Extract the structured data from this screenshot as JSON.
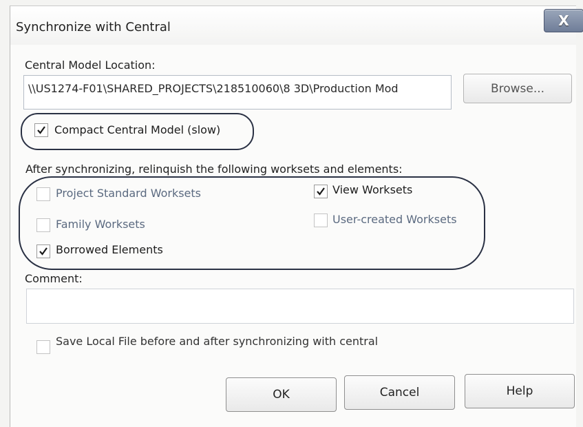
{
  "dialog": {
    "title": "Synchronize with Central",
    "close_glyph": "X"
  },
  "central_model": {
    "label": "Central Model Location:",
    "path": "\\\\US1274-F01\\SHARED_PROJECTS\\218510060\\8 3D\\Production Mod",
    "browse_label": "Browse..."
  },
  "compact": {
    "label": "Compact Central Model (slow)",
    "checked": true
  },
  "relinquish": {
    "heading": "After synchronizing, relinquish the following worksets and elements:",
    "items": [
      {
        "label": "Project Standard Worksets",
        "checked": false,
        "enabled": false
      },
      {
        "label": "Family Worksets",
        "checked": false,
        "enabled": false
      },
      {
        "label": "Borrowed Elements",
        "checked": true,
        "enabled": true
      },
      {
        "label": "View Worksets",
        "checked": true,
        "enabled": true
      },
      {
        "label": "User-created Worksets",
        "checked": false,
        "enabled": false
      }
    ]
  },
  "comment": {
    "label": "Comment:",
    "value": ""
  },
  "save_local": {
    "label": "Save Local File before and after synchronizing with central",
    "checked": false
  },
  "buttons": {
    "ok": "OK",
    "cancel": "Cancel",
    "help": "Help"
  },
  "icons": {
    "close": "close-icon",
    "check": "checkmark-icon"
  }
}
